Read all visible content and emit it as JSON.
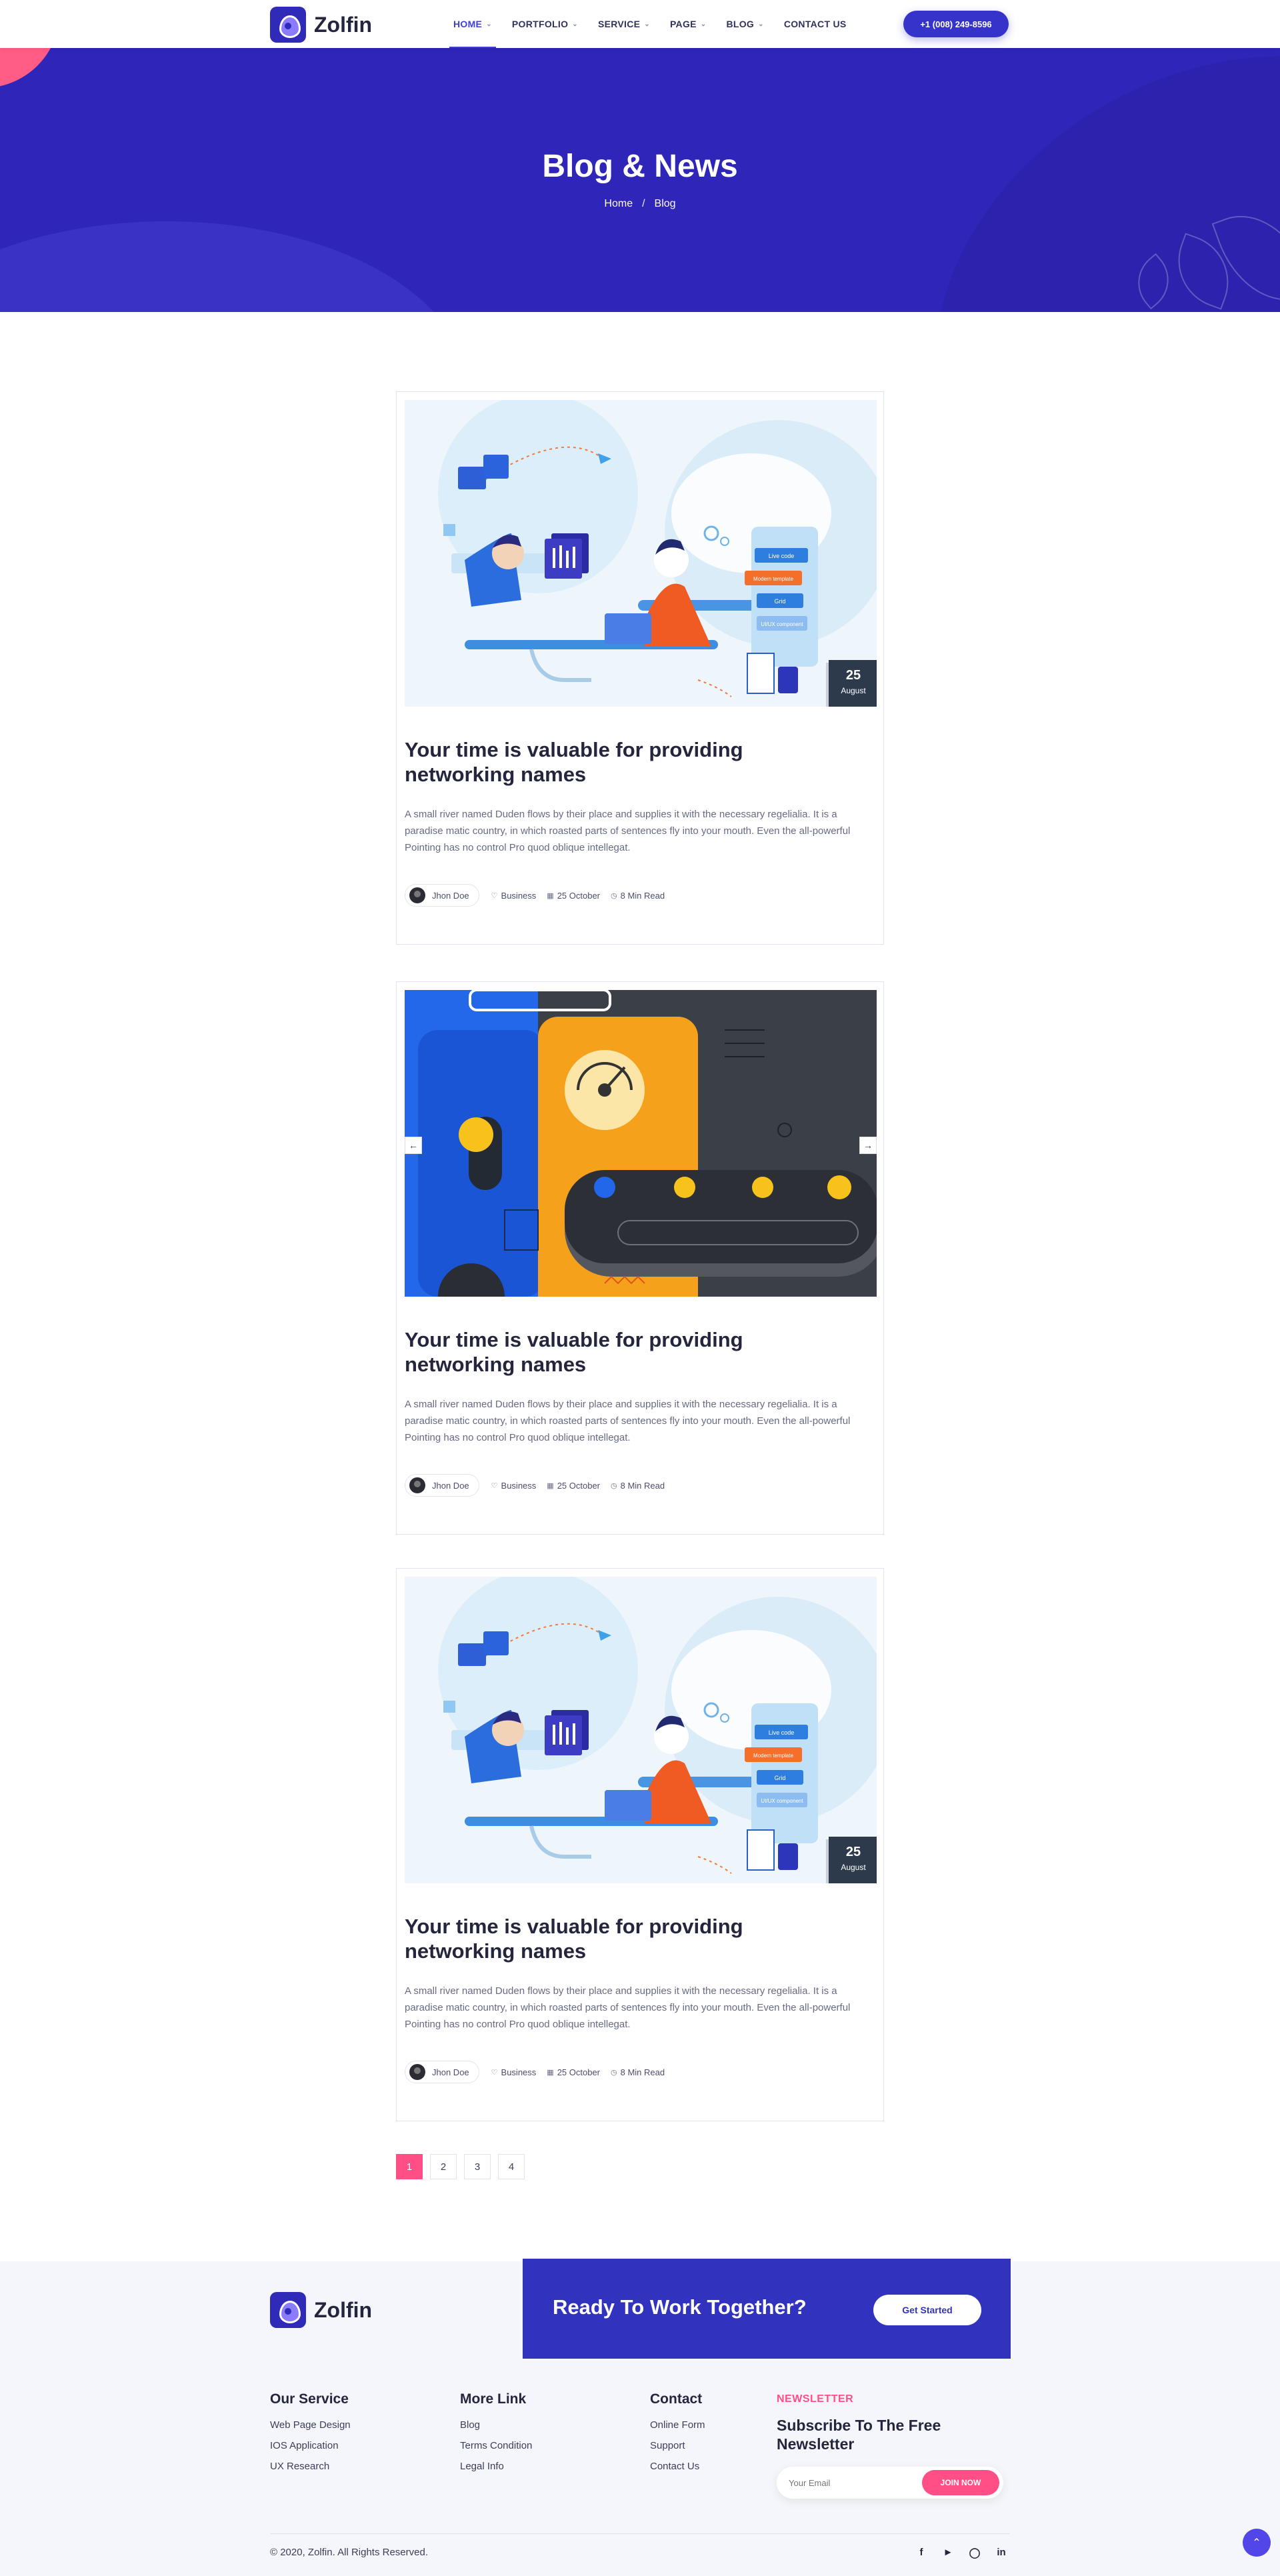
{
  "brand": {
    "name": "Zolfin"
  },
  "nav": {
    "items": [
      {
        "label": "HOME",
        "dropdown": true,
        "active": true
      },
      {
        "label": "PORTFOLIO",
        "dropdown": true
      },
      {
        "label": "SERVICE",
        "dropdown": true
      },
      {
        "label": "PAGE",
        "dropdown": true
      },
      {
        "label": "BLOG",
        "dropdown": true
      },
      {
        "label": "CONTACT US",
        "dropdown": false
      }
    ],
    "phone": "+1 (008) 249-8596"
  },
  "hero": {
    "title": "Blog & News",
    "breadcrumb": {
      "home": "Home",
      "sep": "/",
      "current": "Blog"
    }
  },
  "posts": [
    {
      "image": "team-illustration",
      "date_day": "25",
      "date_month": "August",
      "title": "Your time is valuable for providing networking names",
      "excerpt": "A small river named Duden flows by their place and supplies it with the necessary regelialia. It is a paradise matic country, in which roasted parts of sentences fly into your mouth. Even the all-powerful Pointing has no control Pro quod oblique intellegat.",
      "author": "Jhon Doe",
      "category": "Business",
      "date": "25 October",
      "read_time": "8 Min Read"
    },
    {
      "image": "abstract-slider",
      "title": "Your time is valuable for providing networking names",
      "excerpt": "A small river named Duden flows by their place and supplies it with the necessary regelialia. It is a paradise matic country, in which roasted parts of sentences fly into your mouth. Even the all-powerful Pointing has no control Pro quod oblique intellegat.",
      "author": "Jhon Doe",
      "category": "Business",
      "date": "25 October",
      "read_time": "8 Min Read"
    },
    {
      "image": "team-illustration",
      "date_day": "25",
      "date_month": "August",
      "title": "Your time is valuable for providing networking names",
      "excerpt": "A small river named Duden flows by their place and supplies it with the necessary regelialia. It is a paradise matic country, in which roasted parts of sentences fly into your mouth. Even the all-powerful Pointing has no control Pro quod oblique intellegat.",
      "author": "Jhon Doe",
      "category": "Business",
      "date": "25 October",
      "read_time": "8 Min Read"
    }
  ],
  "illustration_labels": {
    "a": "Live code",
    "b": "Modern template",
    "c": "Grid",
    "d": "UI/UX component"
  },
  "pagination": {
    "pages": [
      "1",
      "2",
      "3",
      "4"
    ],
    "current": "1"
  },
  "cta": {
    "title": "Ready To Work Together?",
    "button": "Get Started"
  },
  "footer": {
    "col1": {
      "title": "Our Service",
      "links": [
        "Web Page Design",
        "IOS Application",
        "UX Research"
      ]
    },
    "col2": {
      "title": "More Link",
      "links": [
        "Blog",
        "Terms Condition",
        "Legal Info"
      ]
    },
    "col3": {
      "title": "Contact",
      "links": [
        "Online Form",
        "Support",
        "Contact Us"
      ]
    },
    "newsletter": {
      "label": "NEWSLETTER",
      "title": "Subscribe To The Free Newsletter",
      "placeholder": "Your Email",
      "button": "JOIN NOW"
    },
    "copyright": "© 2020, Zolfin. All Rights Reserved.",
    "socials": [
      "f",
      "t",
      "ig",
      "in"
    ]
  },
  "colors": {
    "primary": "#2f25b9",
    "accent": "#ff4f86",
    "dark": "#23263d"
  }
}
